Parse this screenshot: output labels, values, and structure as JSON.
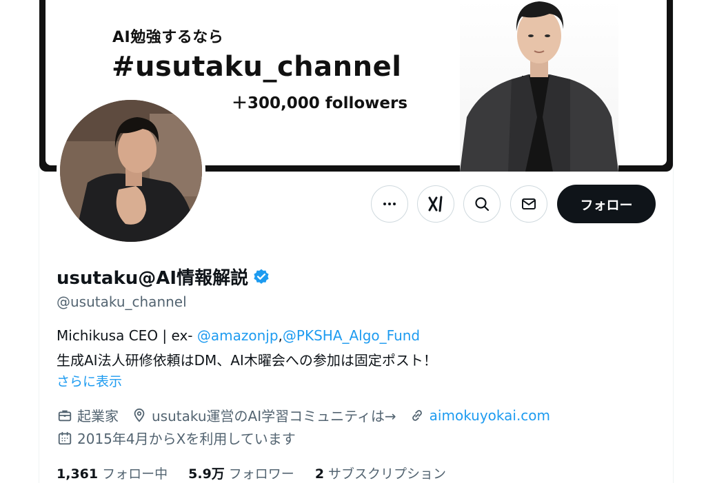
{
  "banner": {
    "subtitle": "AI勉強するなら",
    "title": "#usutaku_channel",
    "followers_text": "＋300,000 followers"
  },
  "actions": {
    "more_icon": "more-horizontal-icon",
    "grok_icon": "grok-icon",
    "search_icon": "search-icon",
    "mail_icon": "mail-icon",
    "follow_label": "フォロー"
  },
  "profile": {
    "display_name": "usutaku@AI情報解説",
    "verified_icon": "verified-badge-icon",
    "verified_color": "#1d9bf0",
    "handle": "@usutaku_channel",
    "bio": {
      "line1_prefix": "Michikusa CEO | ex- ",
      "mention1": "@amazonjp",
      "separator": ",",
      "mention2": "@PKSHA_Algo_Fund",
      "line2": "生成AI法人研修依頼はDM、AI木曜会への参加は固定ポスト！"
    },
    "show_more": "さらに表示",
    "meta": {
      "profession": "起業家",
      "location": "usutaku運営のAI学習コミュニティは→",
      "website": "aimokuyokai.com",
      "joined": "2015年4月からXを利用しています"
    },
    "stats": {
      "following_count": "1,361",
      "following_label": "フォロー中",
      "followers_count": "5.9万",
      "followers_label": "フォロワー",
      "subscriptions_count": "2",
      "subscriptions_label": "サブスクリプション"
    }
  },
  "colors": {
    "link": "#1d9bf0",
    "text_primary": "#0f1419",
    "text_secondary": "#536471",
    "follow_button_bg": "#0f1419"
  }
}
